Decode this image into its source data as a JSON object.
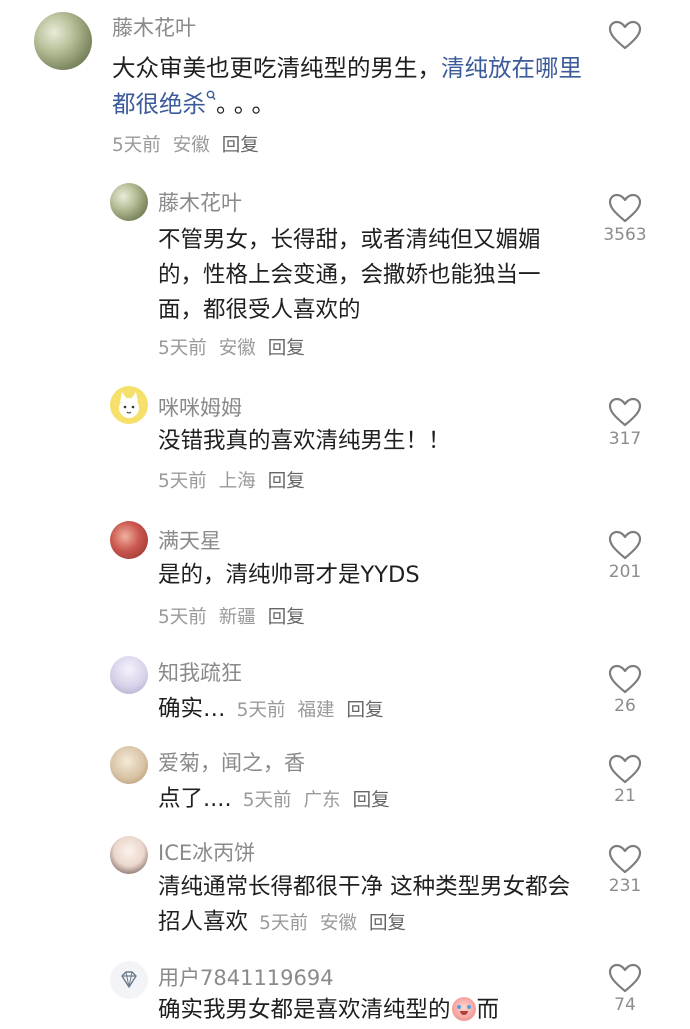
{
  "comments": [
    {
      "user": "藤木花叶",
      "text_plain": "大众审美也更吃清纯型的男生，",
      "text_link": "清纯放在哪里都很绝杀",
      "text_tail": "。。。",
      "time": "5天前",
      "location": "安徽",
      "reply_label": "回复",
      "likes": "",
      "avatar_icon": "flower-photo-avatar",
      "avatar_color": "#a9b28f"
    },
    {
      "user": "藤木花叶",
      "text": "不管男女，长得甜，或者清纯但又媚媚的，性格上会变通，会撒娇也能独当一面，都很受人喜欢的",
      "time": "5天前",
      "location": "安徽",
      "reply_label": "回复",
      "likes": "3563",
      "avatar_icon": "flower-photo-avatar",
      "avatar_color": "#a9b28f"
    },
    {
      "user": "咪咪姆姆",
      "text": "没错我真的喜欢清纯男生！！",
      "time": "5天前",
      "location": "上海",
      "reply_label": "回复",
      "likes": "317",
      "avatar_icon": "cartoon-cat-avatar",
      "avatar_color": "#f4e06a"
    },
    {
      "user": "满天星",
      "text": "是的，清纯帅哥才是YYDS",
      "time": "5天前",
      "location": "新疆",
      "reply_label": "回复",
      "likes": "201",
      "avatar_icon": "red-photo-avatar",
      "avatar_color": "#b8423f"
    },
    {
      "user": "知我疏狂",
      "text": "确实…",
      "time": "5天前",
      "location": "福建",
      "reply_label": "回复",
      "likes": "26",
      "avatar_icon": "anime-girl-avatar",
      "avatar_color": "#d9d4e8"
    },
    {
      "user": "爱菊，闻之，香",
      "text": "点了....",
      "time": "5天前",
      "location": "广东",
      "reply_label": "回复",
      "likes": "21",
      "avatar_icon": "beige-photo-avatar",
      "avatar_color": "#d8c3a4"
    },
    {
      "user": "ICE冰丙饼",
      "text": "清纯通常长得都很干净 这种类型男女都会招人喜欢",
      "time": "5天前",
      "location": "安徽",
      "reply_label": "回复",
      "likes": "231",
      "avatar_icon": "girl-photo-avatar",
      "avatar_color": "#f0e0d8"
    },
    {
      "user": "用户7841119694",
      "text": "确实我男女都是喜欢清纯型的",
      "text_tail": "而",
      "time": "",
      "location": "",
      "reply_label": "",
      "likes": "74",
      "avatar_icon": "diamond-default-avatar",
      "avatar_color": "#f2f4f7"
    }
  ]
}
